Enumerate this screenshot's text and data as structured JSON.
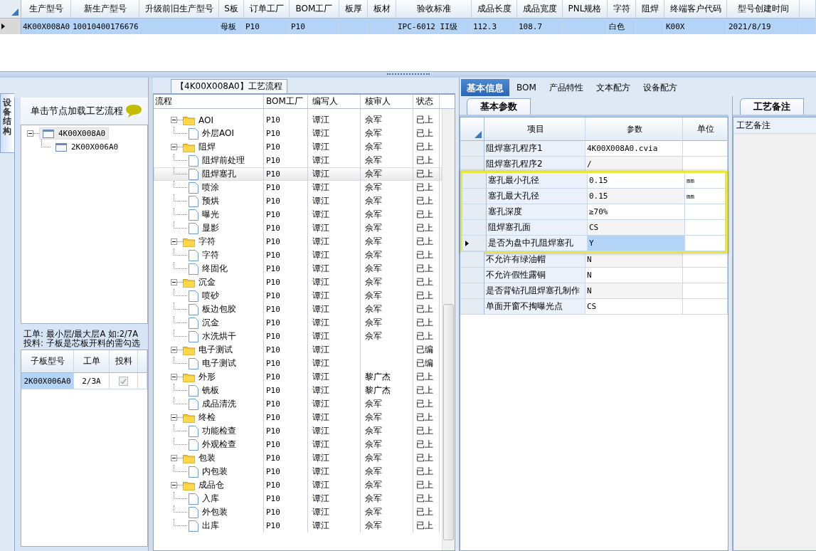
{
  "top_grid": {
    "columns": [
      "生产型号",
      "新生产型号",
      "升级前旧生产型号",
      "S板",
      "订单工厂",
      "BOM工厂",
      "板厚",
      "板材",
      "验收标准",
      "成品长度",
      "成品宽度",
      "PNL规格",
      "字符",
      "阻焊",
      "终端客户代码",
      "型号创建时间"
    ],
    "rows": [
      {
        "selected": true,
        "cells": [
          "4K00X008A0",
          "10010400176676",
          null,
          "母板",
          "P10",
          "P10",
          null,
          null,
          "IPC-6012 II级",
          "112.3",
          "108.7",
          null,
          "白色",
          null,
          "K00X",
          "2021/8/19"
        ]
      }
    ]
  },
  "left_panel": {
    "side_tab": "设备结构",
    "hint": "单击节点加载工艺流程",
    "tree": [
      {
        "label": "4K00X008A0",
        "selected": true,
        "expanded": true,
        "children": [
          {
            "label": "2K00X006A0",
            "selected": false
          }
        ]
      }
    ],
    "notes": [
      "工单: 最小层/最大层A 如:2/7A",
      "投料: 子板是芯板开料的需勾选"
    ],
    "grid": {
      "columns": [
        "子板型号",
        "工单",
        "投料"
      ],
      "rows": [
        {
          "model": "2K00X006A0",
          "order": "2/3A",
          "checked": true,
          "selected": true
        }
      ]
    }
  },
  "flow": {
    "title": "【4K00X008A0】工艺流程",
    "columns": [
      "流程",
      "BOM工厂",
      "编写人",
      "核审人",
      "状态"
    ],
    "nodes": [
      {
        "name": "AOI",
        "bom": "P10",
        "writer": "谭江",
        "reviewer": "佘军",
        "status": "已上",
        "selected": false,
        "expanded": true,
        "children": [
          {
            "name": "外层AOI",
            "bom": "P10",
            "writer": "谭江",
            "reviewer": "佘军",
            "status": "已上",
            "selected": false
          }
        ]
      },
      {
        "name": "阻焊",
        "bom": "P10",
        "writer": "谭江",
        "reviewer": "佘军",
        "status": "已上",
        "selected": false,
        "expanded": true,
        "children": [
          {
            "name": "阻焊前处理",
            "bom": "P10",
            "writer": "谭江",
            "reviewer": "佘军",
            "status": "已上",
            "selected": false
          },
          {
            "name": "阻焊塞孔",
            "bom": "P10",
            "writer": "谭江",
            "reviewer": "佘军",
            "status": "已上",
            "selected": true
          },
          {
            "name": "喷涂",
            "bom": "P10",
            "writer": "谭江",
            "reviewer": "佘军",
            "status": "已上",
            "selected": false
          },
          {
            "name": "预烘",
            "bom": "P10",
            "writer": "谭江",
            "reviewer": "佘军",
            "status": "已上",
            "selected": false
          },
          {
            "name": "曝光",
            "bom": "P10",
            "writer": "谭江",
            "reviewer": "佘军",
            "status": "已上",
            "selected": false
          },
          {
            "name": "显影",
            "bom": "P10",
            "writer": "谭江",
            "reviewer": "佘军",
            "status": "已上",
            "selected": false
          }
        ]
      },
      {
        "name": "字符",
        "bom": "P10",
        "writer": "谭江",
        "reviewer": "佘军",
        "status": "已上",
        "selected": false,
        "expanded": true,
        "children": [
          {
            "name": "字符",
            "bom": "P10",
            "writer": "谭江",
            "reviewer": "佘军",
            "status": "已上",
            "selected": false
          },
          {
            "name": "终固化",
            "bom": "P10",
            "writer": "谭江",
            "reviewer": "佘军",
            "status": "已上",
            "selected": false
          }
        ]
      },
      {
        "name": "沉金",
        "bom": "P10",
        "writer": "谭江",
        "reviewer": "佘军",
        "status": "已上",
        "selected": false,
        "expanded": true,
        "children": [
          {
            "name": "喷砂",
            "bom": "P10",
            "writer": "谭江",
            "reviewer": "佘军",
            "status": "已上",
            "selected": false
          },
          {
            "name": "板边包胶",
            "bom": "P10",
            "writer": "谭江",
            "reviewer": "佘军",
            "status": "已上",
            "selected": false
          },
          {
            "name": "沉金",
            "bom": "P10",
            "writer": "谭江",
            "reviewer": "佘军",
            "status": "已上",
            "selected": false
          },
          {
            "name": "水洗烘干",
            "bom": "P10",
            "writer": "谭江",
            "reviewer": "佘军",
            "status": "已上",
            "selected": false
          }
        ]
      },
      {
        "name": "电子测试",
        "bom": "P10",
        "writer": "谭江",
        "status": "已编",
        "selected": false,
        "expanded": true,
        "children": [
          {
            "name": "电子测试",
            "bom": "P10",
            "writer": "谭江",
            "status": "已编",
            "selected": false
          }
        ]
      },
      {
        "name": "外形",
        "bom": "P10",
        "writer": "谭江",
        "reviewer": "黎广杰",
        "status": "已上",
        "selected": false,
        "expanded": true,
        "children": [
          {
            "name": "铣板",
            "bom": "P10",
            "writer": "谭江",
            "reviewer": "黎广杰",
            "status": "已上",
            "selected": false
          },
          {
            "name": "成品清洗",
            "bom": "P10",
            "writer": "谭江",
            "reviewer": "佘军",
            "status": "已上",
            "selected": false
          }
        ]
      },
      {
        "name": "终检",
        "bom": "P10",
        "writer": "谭江",
        "reviewer": "佘军",
        "status": "已上",
        "selected": false,
        "expanded": true,
        "children": [
          {
            "name": "功能检查",
            "bom": "P10",
            "writer": "谭江",
            "reviewer": "佘军",
            "status": "已上",
            "selected": false
          },
          {
            "name": "外观检查",
            "bom": "P10",
            "writer": "谭江",
            "reviewer": "佘军",
            "status": "已上",
            "selected": false
          }
        ]
      },
      {
        "name": "包装",
        "bom": "P10",
        "writer": "谭江",
        "reviewer": "佘军",
        "status": "已上",
        "selected": false,
        "expanded": true,
        "children": [
          {
            "name": "内包装",
            "bom": "P10",
            "writer": "谭江",
            "reviewer": "佘军",
            "status": "已上",
            "selected": false
          }
        ]
      },
      {
        "name": "成品仓",
        "bom": "P10",
        "writer": "谭江",
        "reviewer": "佘军",
        "status": "已上",
        "selected": false,
        "expanded": true,
        "children": [
          {
            "name": "入库",
            "bom": "P10",
            "writer": "谭江",
            "reviewer": "佘军",
            "status": "已上",
            "selected": false
          },
          {
            "name": "外包装",
            "bom": "P10",
            "writer": "谭江",
            "reviewer": "佘军",
            "status": "已上",
            "selected": false
          },
          {
            "name": "出库",
            "bom": "P10",
            "writer": "谭江",
            "reviewer": "佘军",
            "status": "已上",
            "selected": false
          }
        ]
      }
    ]
  },
  "info": {
    "tabs": [
      {
        "label": "基本信息",
        "selected": true
      },
      {
        "label": "BOM",
        "selected": false
      },
      {
        "label": "产品特性",
        "selected": false
      },
      {
        "label": "文本配方",
        "selected": false
      },
      {
        "label": "设备配方",
        "selected": false
      }
    ],
    "sub_tab": "基本参数",
    "columns": [
      "项目",
      "参数",
      "单位"
    ],
    "rows": [
      {
        "item": "阻焊塞孔程序1",
        "value": "4K00X008A0.cvia",
        "selected": false,
        "highlighted": false
      },
      {
        "item": "阻焊塞孔程序2",
        "value": "/",
        "selected": false,
        "highlighted": false
      },
      {
        "item": "塞孔最小孔径",
        "value": "0.15",
        "unit": "mm",
        "selected": false,
        "highlighted": true
      },
      {
        "item": "塞孔最大孔径",
        "value": "0.15",
        "unit": "mm",
        "selected": false,
        "highlighted": true
      },
      {
        "item": "塞孔深度",
        "value": "≥70%",
        "selected": false,
        "highlighted": true
      },
      {
        "item": "阻焊塞孔面",
        "value": "CS",
        "selected": false,
        "highlighted": true
      },
      {
        "item": "是否为盘中孔阻焊塞孔",
        "value": "Y",
        "selected": true,
        "highlighted": true
      },
      {
        "item": "不允许有绿油帽",
        "value": "N",
        "selected": false,
        "highlighted": false
      },
      {
        "item": "不允许假性露铜",
        "value": "N",
        "selected": false,
        "highlighted": false
      },
      {
        "item": "是否背钻孔阻焊塞孔制作",
        "value": "N",
        "selected": false,
        "highlighted": false
      },
      {
        "item": "单面开窗不掏曝光点",
        "value": "CS",
        "selected": false,
        "highlighted": false
      }
    ]
  },
  "remarks": {
    "tab": "工艺备注",
    "header": "工艺备注"
  }
}
